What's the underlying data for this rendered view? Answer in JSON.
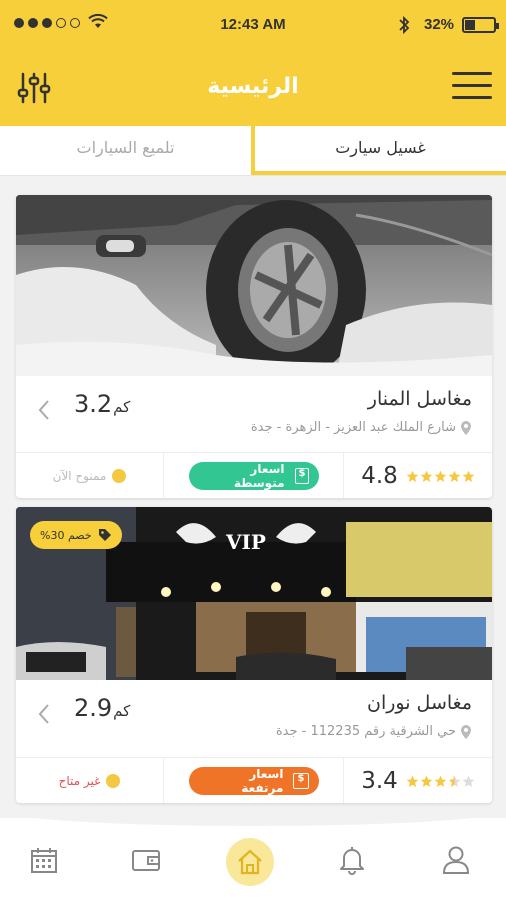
{
  "status": {
    "time": "12:43 AM",
    "battery": "32%",
    "signal_bars_filled": 3,
    "battery_level": 0.32
  },
  "header": {
    "title": "الرئيسية"
  },
  "tabs": [
    {
      "label": "غسيل سيارت",
      "active": true
    },
    {
      "label": "تلميع السيارات",
      "active": false
    }
  ],
  "cards": [
    {
      "name": "مغاسل المنار",
      "address": "شارع الملك عبد العزيز - الزهرة - جدة",
      "distance": "3.2",
      "distance_unit": "كم",
      "permit": "ممنوح الآن",
      "price": "اسعار متوسطة",
      "rating": "4.8",
      "stars": 5,
      "photo": "snowy car tire"
    },
    {
      "name": "مغاسل نوران",
      "address": "حي الشرقية رقم 112235 - جدة",
      "distance": "2.9",
      "distance_unit": "كم",
      "permit": "غير متاح",
      "price": "اسعار مرتفعة",
      "rating": "3.4",
      "stars": 3.5,
      "discount": "خصم 30%",
      "photo": "VIP storefront at night",
      "sign_text": "VIP"
    }
  ],
  "colors": {
    "primary": "#f7cf3a",
    "price_mid": "#32c792",
    "price_high": "#f07427",
    "permit_bad": "#e35151",
    "star": "#f5c842"
  },
  "nav": [
    "calendar-icon",
    "wallet-icon",
    "home-icon",
    "bell-icon",
    "user-icon"
  ]
}
